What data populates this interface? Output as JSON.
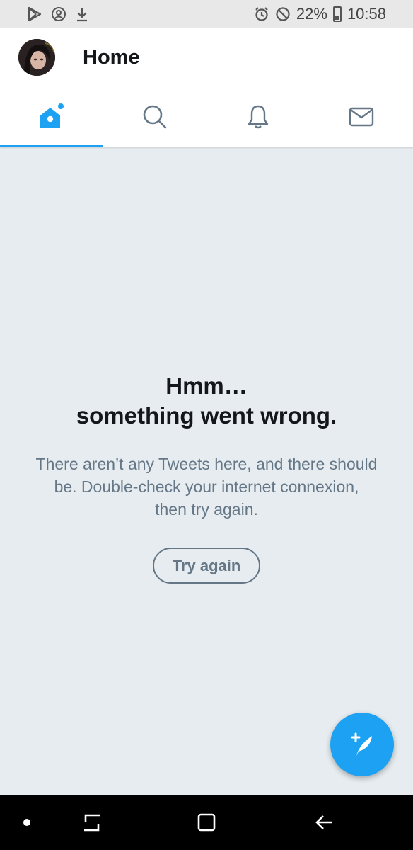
{
  "status_bar": {
    "battery": "22%",
    "time": "10:58",
    "icons": [
      "play-store-icon",
      "account-circle-icon",
      "download-icon",
      "alarm-icon",
      "do-not-disturb-icon",
      "battery-icon"
    ]
  },
  "header": {
    "title": "Home",
    "avatar": "profile-avatar"
  },
  "tabs": [
    {
      "name": "home",
      "icon": "home-icon",
      "active": true
    },
    {
      "name": "search",
      "icon": "search-icon",
      "active": false
    },
    {
      "name": "notifications",
      "icon": "bell-icon",
      "active": false
    },
    {
      "name": "messages",
      "icon": "mail-icon",
      "active": false
    }
  ],
  "empty_state": {
    "title_line1": "Hmm…",
    "title_line2": "something went wrong.",
    "message_line1": "There aren’t any Tweets here, and there should",
    "message_line2": "be. Double-check your internet connexion,",
    "message_line3": "then try again.",
    "button_label": "Try again"
  },
  "fab": {
    "icon": "compose-tweet-icon"
  },
  "nav_bar": {
    "icons": [
      "dot-icon",
      "recent-apps-icon",
      "home-square-icon",
      "back-icon"
    ]
  },
  "colors": {
    "accent": "#1da1f2",
    "background": "#e6ecf0",
    "text_primary": "#14171a",
    "text_secondary": "#657786"
  }
}
